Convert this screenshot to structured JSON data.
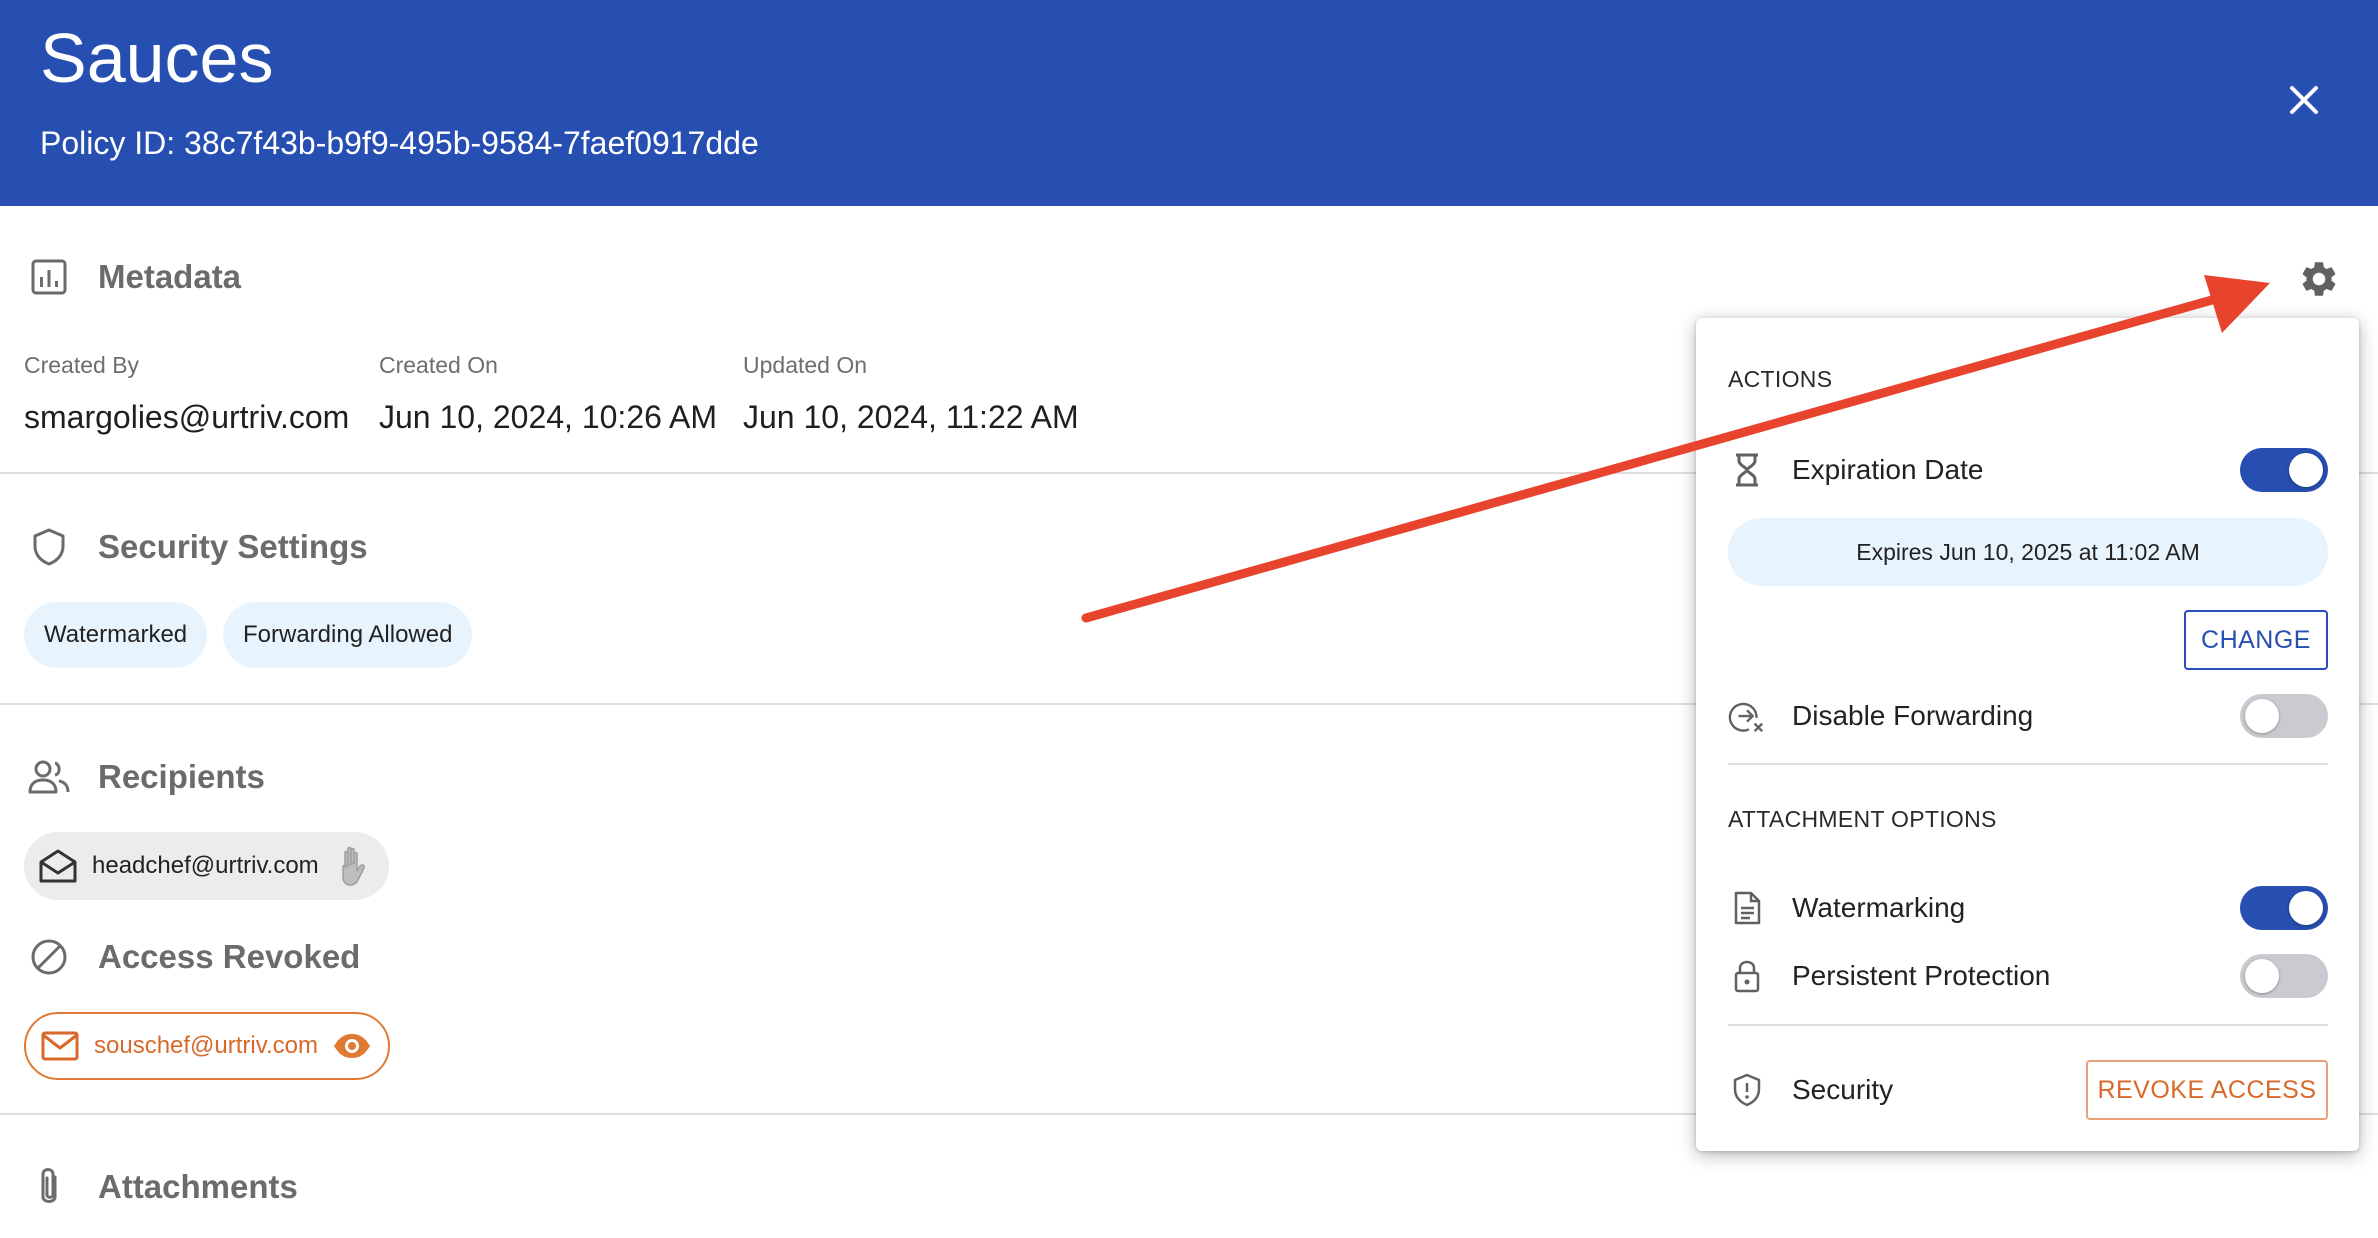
{
  "header": {
    "title": "Sauces",
    "policy_id": "Policy ID: 38c7f43b-b9f9-495b-9584-7faef0917dde",
    "close_icon": "close-icon"
  },
  "metadata": {
    "title": "Metadata",
    "icon": "bar-chart-icon",
    "created_by_label": "Created By",
    "created_by_value": "smargolies@urtriv.com",
    "created_on_label": "Created On",
    "created_on_value": "Jun 10, 2024, 10:26 AM",
    "updated_on_label": "Updated On",
    "updated_on_value": "Jun 10, 2024, 11:22 AM"
  },
  "security": {
    "title": "Security Settings",
    "icon": "shield-icon",
    "chips": [
      "Watermarked",
      "Forwarding Allowed"
    ]
  },
  "recipients": {
    "title": "Recipients",
    "icon": "people-icon",
    "items": [
      {
        "email": "headchef@urtriv.com",
        "icon": "envelope-open-icon",
        "action_icon": "hand-icon"
      }
    ]
  },
  "revoked": {
    "title": "Access Revoked",
    "icon": "block-icon",
    "items": [
      {
        "email": "souschef@urtriv.com",
        "icon": "envelope-icon",
        "action_icon": "eye-icon"
      }
    ]
  },
  "attachments": {
    "title": "Attachments",
    "icon": "paperclip-icon"
  },
  "popover": {
    "actions_header": "ACTIONS",
    "expiration_label": "Expiration Date",
    "expiration_on": true,
    "expiry_text": "Expires Jun 10, 2025 at 11:02 AM",
    "change_label": "CHANGE",
    "disable_forwarding_label": "Disable Forwarding",
    "disable_forwarding_on": false,
    "attachment_header": "ATTACHMENT OPTIONS",
    "watermarking_label": "Watermarking",
    "watermarking_on": true,
    "persistent_label": "Persistent Protection",
    "persistent_on": false,
    "security_label": "Security",
    "revoke_label": "REVOKE ACCESS"
  },
  "colors": {
    "brand": "#274eb1",
    "accent_orange": "#d9692a",
    "chip_bg": "#e7f3fd",
    "annotation_arrow": "#e8432d"
  }
}
